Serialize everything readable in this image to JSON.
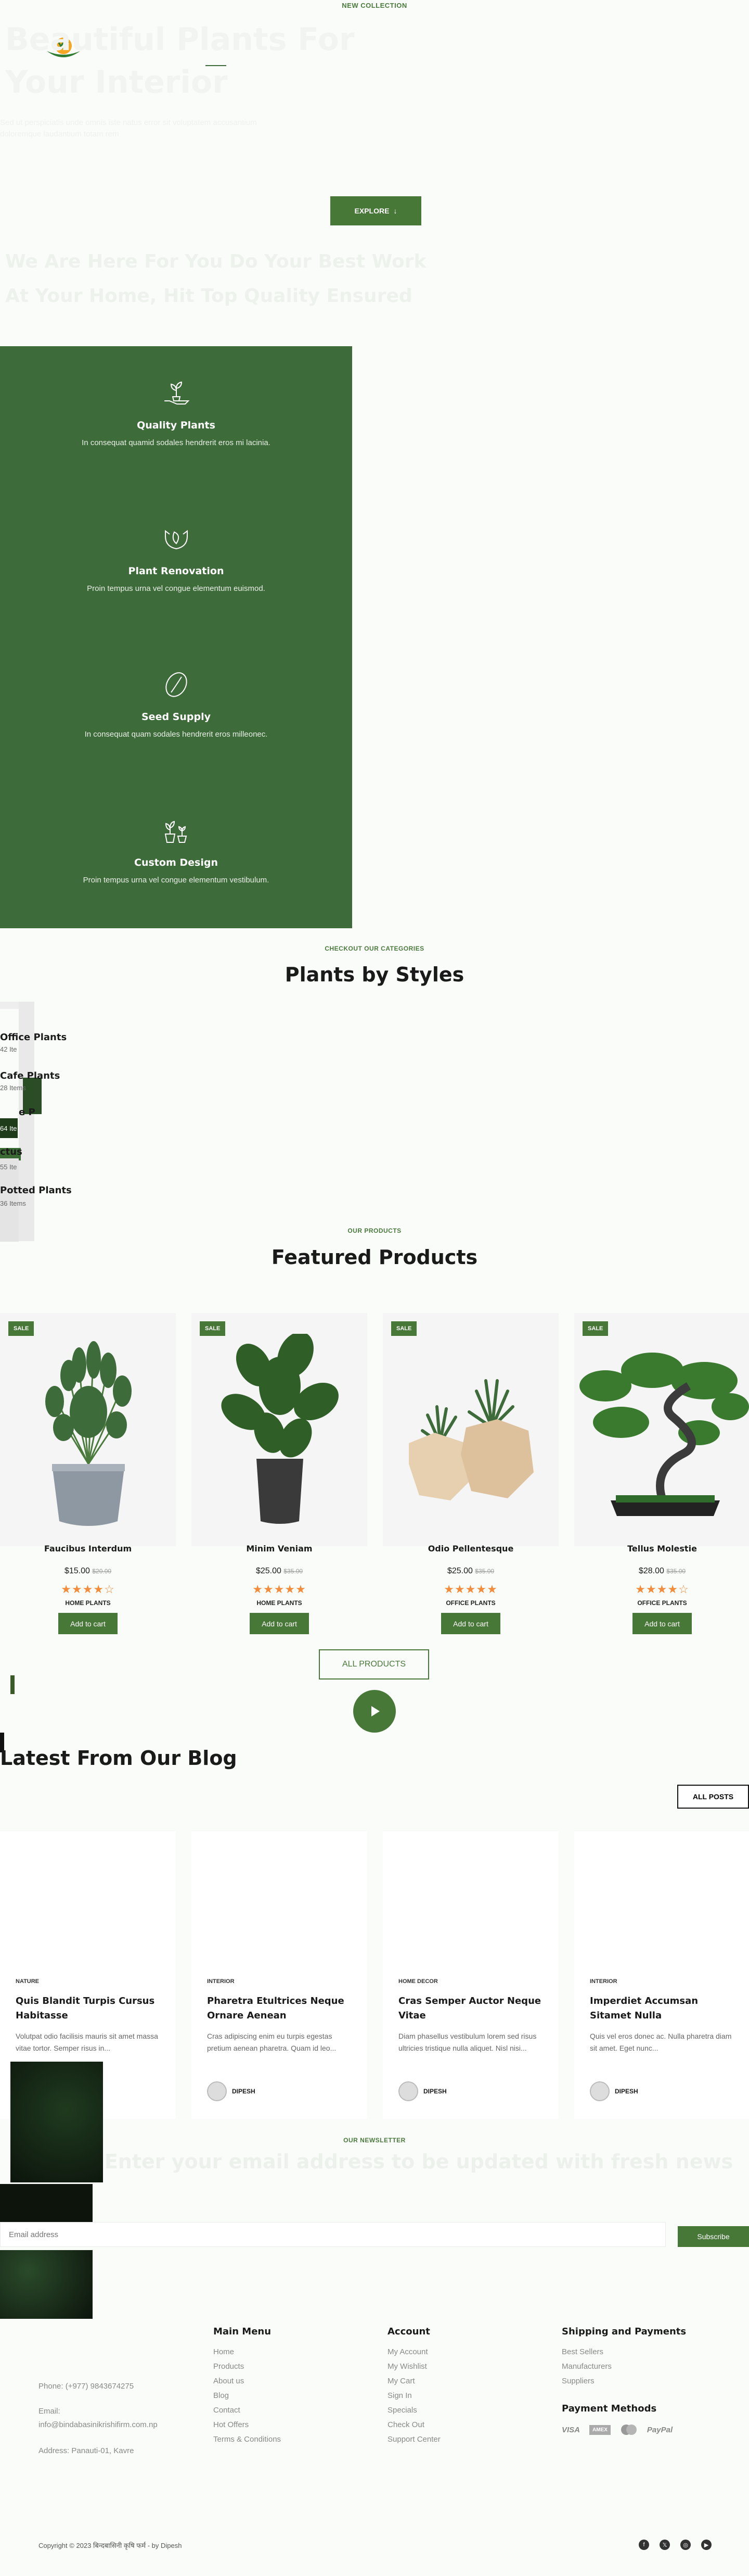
{
  "header": {
    "kicker": "NEW COLLECTION",
    "hero_title": "Beautiful Plants For Your Interior",
    "hero_subtitle": "Sed ut perspiciatis unde omnis iste natus error sit voluptatem accusantium doloremque laudantium totam rem",
    "explore_label": "EXPLORE",
    "sub_cta": "We Are Here For You Do Your Best Work At Your Home, Hit Top Quality Ensured"
  },
  "services": [
    {
      "icon": "hand-plant-icon",
      "title": "Quality Plants",
      "text": "In consequat quamid sodales hendrerit eros mi lacinia."
    },
    {
      "icon": "hands-leaf-icon",
      "title": "Plant Renovation",
      "text": "Proin tempus urna vel congue elementum euismod."
    },
    {
      "icon": "seed-icon",
      "title": "Seed Supply",
      "text": "In consequat quam sodales hendrerit eros milleonec."
    },
    {
      "icon": "potted-plants-icon",
      "title": "Custom Design",
      "text": "Proin tempus urna vel congue elementum vestibulum."
    }
  ],
  "categories": {
    "kicker": "CHECKOUT OUR CATEGORIES",
    "title": "Plants by Styles",
    "items": [
      {
        "name": "Office Plants",
        "count": "42 Ite"
      },
      {
        "name": "Cafe Plants",
        "count": "28 Items"
      },
      {
        "name": "e P",
        "count": "64 Ite"
      },
      {
        "name": "ctus",
        "count": "55 Ite"
      },
      {
        "name": "Potted Plants",
        "count": "36 Items"
      }
    ]
  },
  "products": {
    "kicker": "OUR PRODUCTS",
    "title": "Featured Products",
    "sale_label": "SALE",
    "cart_label": "Add to cart",
    "all_label": "ALL PRODUCTS",
    "items": [
      {
        "name": "Faucibus Interdum",
        "price": "$15.00",
        "old": "$20.00",
        "stars": "★★★★☆",
        "category": "HOME PLANTS"
      },
      {
        "name": "Minim Veniam",
        "price": "$25.00",
        "old": "$35.00",
        "stars": "★★★★★",
        "category": "HOME PLANTS"
      },
      {
        "name": "Odio Pellentesque",
        "price": "$25.00",
        "old": "$35.00",
        "stars": "★★★★★",
        "category": "OFFICE PLANTS"
      },
      {
        "name": "Tellus Molestie",
        "price": "$28.00",
        "old": "$35.00",
        "stars": "★★★★☆",
        "category": "OFFICE PLANTS"
      }
    ]
  },
  "blog": {
    "title": "Latest From Our Blog",
    "all_label": "ALL POSTS",
    "posts": [
      {
        "category": "NATURE",
        "title": "Quis Blandit Turpis Cursus Habitasse",
        "excerpt": "Volutpat odio facilisis mauris sit amet massa vitae tortor. Semper risus in...",
        "author": "DIPESH"
      },
      {
        "category": "INTERIOR",
        "title": "Pharetra Etultrices Neque Ornare Aenean",
        "excerpt": "Cras adipiscing enim eu turpis egestas pretium aenean pharetra. Quam id leo...",
        "author": "DIPESH"
      },
      {
        "category": "HOME DECOR",
        "title": "Cras Semper Auctor Neque Vitae",
        "excerpt": "Diam phasellus vestibulum lorem sed risus ultricies tristique nulla aliquet. Nisl nisi...",
        "author": "DIPESH"
      },
      {
        "category": "INTERIOR",
        "title": "Imperdiet Accumsan Sitamet Nulla",
        "excerpt": "Quis vel eros donec ac. Nulla pharetra diam sit amet. Eget nunc...",
        "author": "DIPESH"
      }
    ]
  },
  "newsletter": {
    "kicker": "OUR NEWSLETTER",
    "title": "Enter your email address to be updated with fresh news",
    "placeholder": "Email address",
    "button": "Subscribe"
  },
  "footer": {
    "phone": "Phone: (+977) 9843674275",
    "email_label": "Email:",
    "email": "info@bindabasinikrishifirm.com.np",
    "address": "Address: Panauti-01, Kavre",
    "main_menu": {
      "title": "Main Menu",
      "links": [
        "Home",
        "Products",
        "About us",
        "Blog",
        "Contact",
        "Hot Offers",
        "Terms & Conditions"
      ]
    },
    "account": {
      "title": "Account",
      "links": [
        "My Account",
        "My Wishlist",
        "My Cart",
        "Sign In",
        "Specials",
        "Check Out",
        "Support Center"
      ]
    },
    "shipping": {
      "title": "Shipping and Payments",
      "links": [
        "Best Sellers",
        "Manufacturers",
        "Suppliers"
      ]
    },
    "payment_title": "Payment Methods",
    "payments": [
      "VISA",
      "AMEX",
      "MC",
      "PayPal"
    ],
    "copyright": "Copyright © 2023 बिन्दबासिनी कृषि फर्म - by Dipesh"
  },
  "colors": {
    "primary": "#477838",
    "dark_green": "#3e6b3a",
    "star": "#f28c3a"
  }
}
